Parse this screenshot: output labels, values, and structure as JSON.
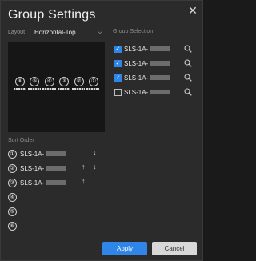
{
  "dialog": {
    "title": "Group Settings",
    "close_icon": "close-icon"
  },
  "layout": {
    "label": "Layout",
    "value": "Horizontal-Top",
    "chevron_icon": "chevron-down-icon"
  },
  "preview": {
    "slots": [
      "⑥",
      "⑤",
      "④",
      "③",
      "②",
      "①"
    ]
  },
  "group_selection": {
    "label": "Group Selection",
    "items": [
      {
        "name": "SLS-1A-",
        "checked": true
      },
      {
        "name": "SLS-1A-",
        "checked": true
      },
      {
        "name": "SLS-1A-",
        "checked": true
      },
      {
        "name": "SLS-1A-",
        "checked": false
      }
    ],
    "check_mark": "✓",
    "search_icon": "search-icon"
  },
  "sort_order": {
    "label": "Sort Order",
    "rows": [
      {
        "badge": "①",
        "name": "SLS-1A-",
        "up": false,
        "down": true
      },
      {
        "badge": "②",
        "name": "SLS-1A-",
        "up": true,
        "down": true
      },
      {
        "badge": "③",
        "name": "SLS-1A-",
        "up": true,
        "down": false
      },
      {
        "badge": "④",
        "name": "",
        "up": false,
        "down": false
      },
      {
        "badge": "⑤",
        "name": "",
        "up": false,
        "down": false
      },
      {
        "badge": "⑥",
        "name": "",
        "up": false,
        "down": false
      }
    ],
    "up_glyph": "↑",
    "down_glyph": "↓"
  },
  "buttons": {
    "apply": "Apply",
    "cancel": "Cancel"
  },
  "colors": {
    "accent": "#2f86e8",
    "background": "#2b2b2b"
  }
}
